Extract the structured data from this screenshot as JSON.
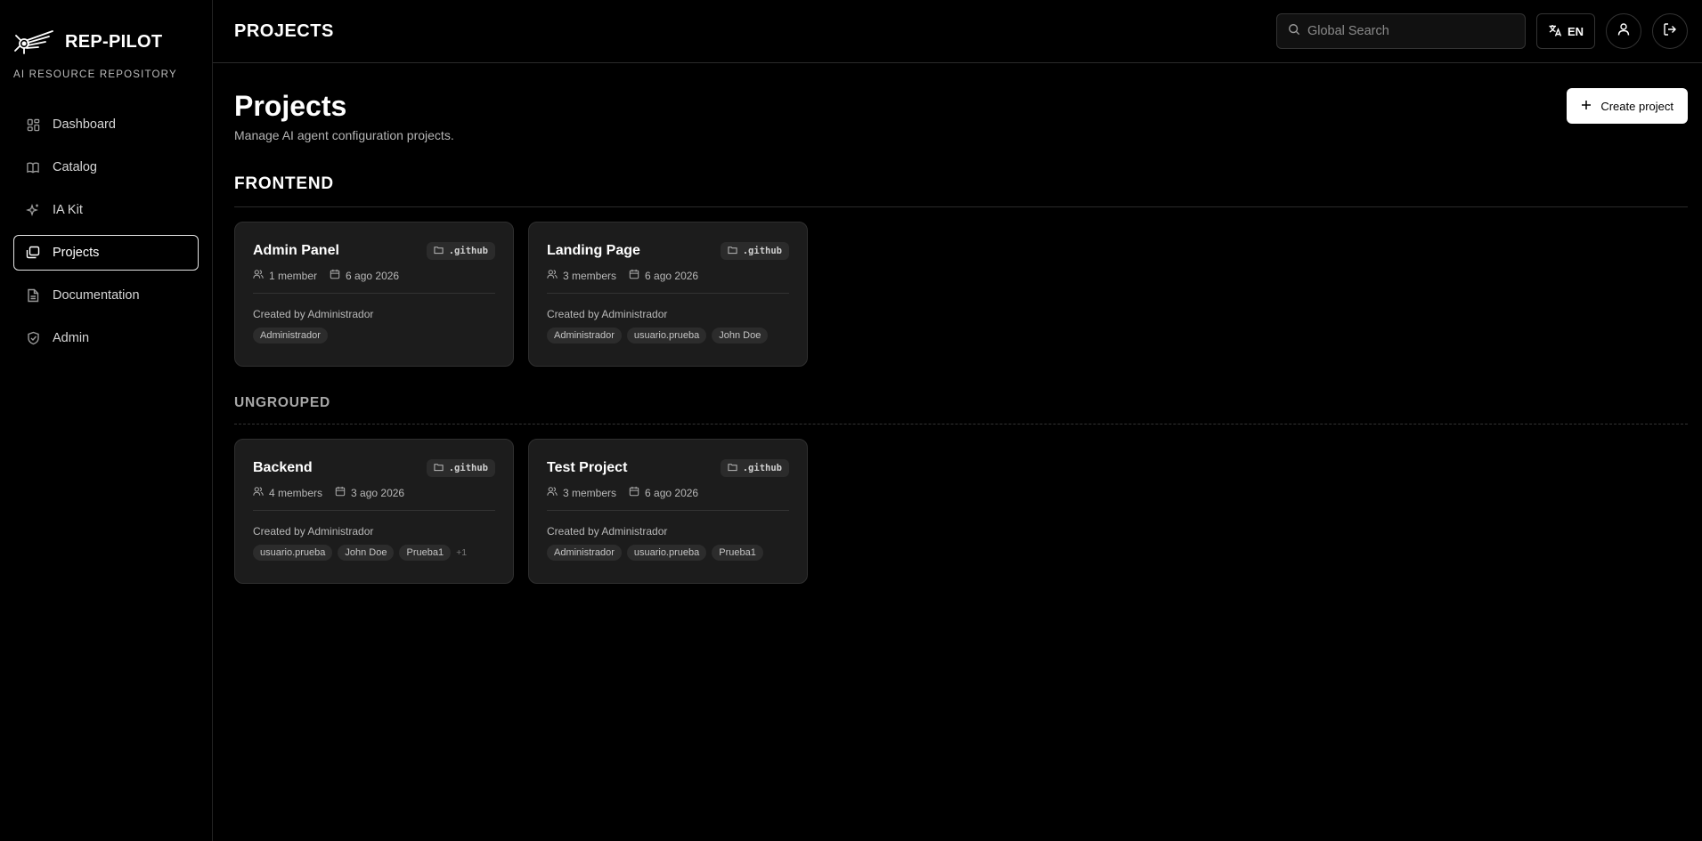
{
  "brand": {
    "name": "REP-PILOT",
    "subtitle": "AI RESOURCE REPOSITORY"
  },
  "sidebar": {
    "items": [
      {
        "label": "Dashboard",
        "icon": "dashboard-icon"
      },
      {
        "label": "Catalog",
        "icon": "book-icon"
      },
      {
        "label": "IA Kit",
        "icon": "sparkles-icon"
      },
      {
        "label": "Projects",
        "icon": "folders-icon",
        "active": true
      },
      {
        "label": "Documentation",
        "icon": "document-icon"
      },
      {
        "label": "Admin",
        "icon": "shield-icon"
      }
    ]
  },
  "topbar": {
    "title": "PROJECTS",
    "search_placeholder": "Global Search",
    "lang_label": "EN"
  },
  "page": {
    "title": "Projects",
    "subtitle": "Manage AI agent configuration projects.",
    "create_label": "Create project"
  },
  "groups": [
    {
      "name": "FRONTEND",
      "projects": [
        {
          "title": "Admin Panel",
          "folder": ".github",
          "members": "1 member",
          "date": "6 ago 2026",
          "created": "Created by Administrador",
          "tags": [
            "Administrador"
          ],
          "more": ""
        },
        {
          "title": "Landing Page",
          "folder": ".github",
          "members": "3 members",
          "date": "6 ago 2026",
          "created": "Created by Administrador",
          "tags": [
            "Administrador",
            "usuario.prueba",
            "John Doe"
          ],
          "more": ""
        }
      ]
    },
    {
      "name": "UNGROUPED",
      "projects": [
        {
          "title": "Backend",
          "folder": ".github",
          "members": "4 members",
          "date": "3 ago 2026",
          "created": "Created by Administrador",
          "tags": [
            "usuario.prueba",
            "John Doe",
            "Prueba1"
          ],
          "more": "+1"
        },
        {
          "title": "Test Project",
          "folder": ".github",
          "members": "3 members",
          "date": "6 ago 2026",
          "created": "Created by Administrador",
          "tags": [
            "Administrador",
            "usuario.prueba",
            "Prueba1"
          ],
          "more": ""
        }
      ]
    }
  ],
  "colors": {
    "background": "#000000",
    "card": "#1c1c1c",
    "accent": "#ffffff"
  }
}
